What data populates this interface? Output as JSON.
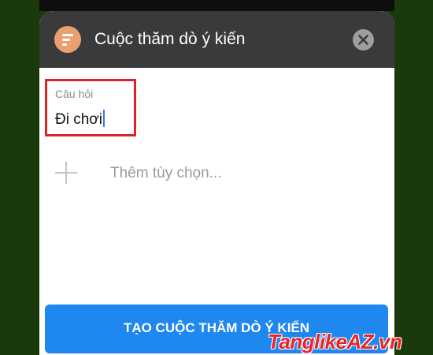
{
  "header": {
    "title": "Cuộc thăm dò ý kiến",
    "app_icon": "poll-icon",
    "close_icon": "close-icon"
  },
  "question": {
    "label": "Câu hỏi",
    "value": "Đi chơi"
  },
  "add_option": {
    "icon": "plus-icon",
    "placeholder": "Thêm tùy chọn..."
  },
  "create_button": {
    "label": "TẠO CUỘC THĂM DÒ Ý KIẾN"
  },
  "watermark": "TanglikeAZ.vn",
  "colors": {
    "header_bg": "#3a3a3a",
    "app_icon_bg": "#e8a071",
    "button_bg": "#1e88f0",
    "highlight_border": "#e0232a",
    "caret": "#2b7de9",
    "page_bg": "#1b3a0b"
  }
}
